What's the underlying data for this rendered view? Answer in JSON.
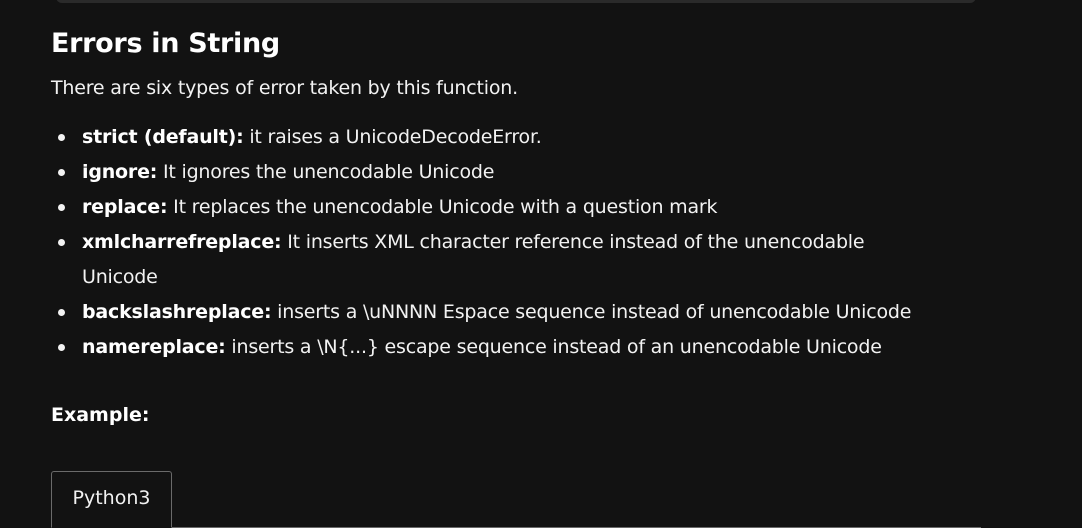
{
  "section": {
    "title": "Errors in String",
    "intro": "There are six types of error taken by this function."
  },
  "errors": [
    {
      "term": "strict (default):",
      "description": " it raises a UnicodeDecodeError."
    },
    {
      "term": "ignore:",
      "description": " It ignores the unencodable Unicode"
    },
    {
      "term": "replace:",
      "description": " It replaces the unencodable Unicode with a question mark"
    },
    {
      "term": "xmlcharrefreplace:",
      "description": " It inserts XML character reference instead of the unencodable Unicode"
    },
    {
      "term": "backslashreplace:",
      "description": " inserts a \\uNNNN Espace sequence instead of unencodable Unicode"
    },
    {
      "term": "namereplace:",
      "description": " inserts a \\N{...} escape sequence instead of an unencodable Unicode"
    }
  ],
  "example": {
    "label": "Example:"
  },
  "code_tabs": {
    "active": "Python3"
  }
}
